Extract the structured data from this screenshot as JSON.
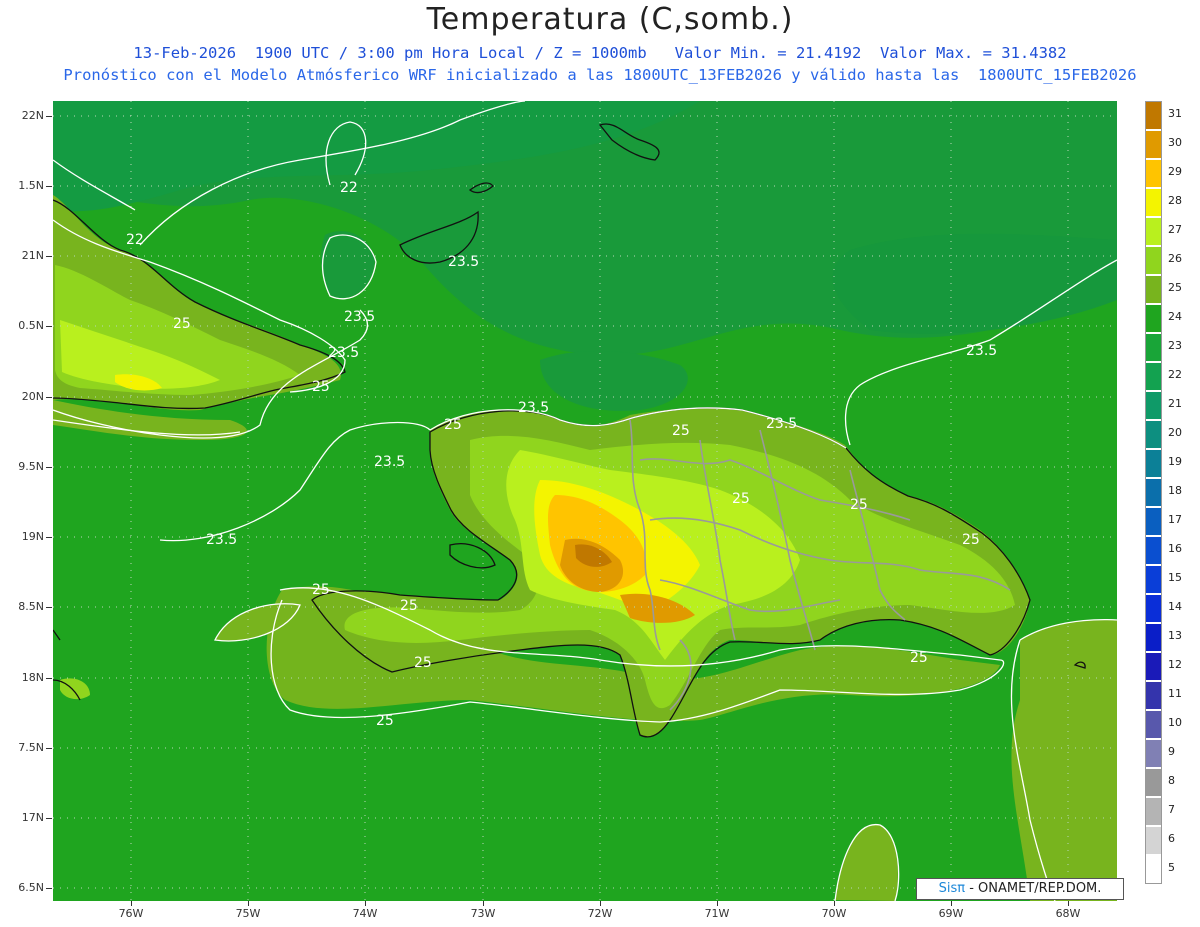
{
  "title": "Temperatura (C,somb.)",
  "subtitle_line1": "13-Feb-2026  1900 UTC / 3:00 pm Hora Local / Z = 1000mb   Valor Min. = 21.4192  Valor Max. = 31.4382",
  "subtitle_line2": "Pronóstico con el Modelo Atmósferico WRF inicializado a las 1800UTC_13FEB2026 y válido hasta las  1800UTC_15FEB2026",
  "lat_labels": [
    "22N",
    "1.5N",
    "21N",
    "0.5N",
    "20N",
    "9.5N",
    "19N",
    "8.5N",
    "18N",
    "7.5N",
    "17N",
    "6.5N"
  ],
  "lon_labels": [
    "76W",
    "75W",
    "74W",
    "73W",
    "72W",
    "71W",
    "70W",
    "69W",
    "68W"
  ],
  "contour_labels": [
    "22",
    "22",
    "23.5",
    "23.5",
    "23.5",
    "23.5",
    "23.5",
    "23.5",
    "23.5",
    "23.5",
    "25",
    "25",
    "25",
    "25",
    "25",
    "25",
    "25",
    "25",
    "25",
    "25",
    "25",
    "25"
  ],
  "colorbar": {
    "values": [
      "31",
      "30",
      "29",
      "28",
      "27",
      "26",
      "25",
      "24",
      "23",
      "22",
      "21",
      "20",
      "19",
      "18",
      "17",
      "16",
      "15",
      "14",
      "13",
      "12",
      "11",
      "10",
      "9",
      "8",
      "7",
      "6",
      "5"
    ],
    "colors": [
      "#c07800",
      "#e09a00",
      "#ffc400",
      "#f4f400",
      "#b9f01e",
      "#90d51e",
      "#78b41e",
      "#1fa51f",
      "#19a538",
      "#13a250",
      "#0f9a68",
      "#0d8f80",
      "#0c8097",
      "#0b6fab",
      "#0a5fc0",
      "#0a4fd0",
      "#0a3ed8",
      "#0a2ed8",
      "#0a1ec8",
      "#1a1ab8",
      "#3434ac",
      "#5858ac",
      "#8080b4",
      "#999999",
      "#b4b4b4",
      "#d4d4d4",
      "#ffffff"
    ]
  },
  "footer": {
    "brand": "Sisπ",
    "text": "- ONAMET/REP.DOM."
  },
  "colors": {
    "ocean_deep": "#199a3a",
    "ocean": "#1fa51f",
    "land_low": "#78b41e",
    "land_mid": "#90d51e",
    "land_high": "#b9f01e",
    "hot1": "#f4f400",
    "hot2": "#ffc400",
    "hot3": "#e09a00",
    "hot4": "#c07800"
  }
}
